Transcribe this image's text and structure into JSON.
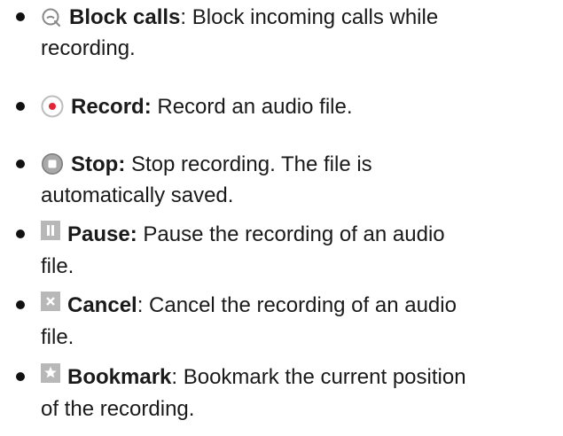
{
  "items": [
    {
      "icon": "block-calls-icon",
      "term": "Block calls",
      "separator": ": ",
      "line1": "Block incoming calls while",
      "line2": "recording."
    },
    {
      "icon": "record-icon",
      "term": "Record:",
      "separator": " ",
      "line1": "Record an audio file.",
      "line2": ""
    },
    {
      "icon": "stop-icon",
      "term": "Stop:",
      "separator": " ",
      "line1": "Stop recording. The file is",
      "line2": "automatically saved."
    },
    {
      "icon": "pause-icon",
      "term": "Pause:",
      "separator": " ",
      "line1": "Pause the recording of an audio",
      "line2": "file."
    },
    {
      "icon": "cancel-icon",
      "term": "Cancel",
      "separator": ": ",
      "line1": "Cancel the recording of an audio",
      "line2": "file."
    },
    {
      "icon": "bookmark-icon",
      "term": "Bookmark",
      "separator": ": ",
      "line1": "Bookmark the current position",
      "line2": "of the recording."
    }
  ],
  "colors": {
    "text": "#1a1a1a",
    "record_red": "#e32636",
    "icon_gray": "#b8b8b8",
    "icon_dark_gray": "#8a8a8a"
  }
}
